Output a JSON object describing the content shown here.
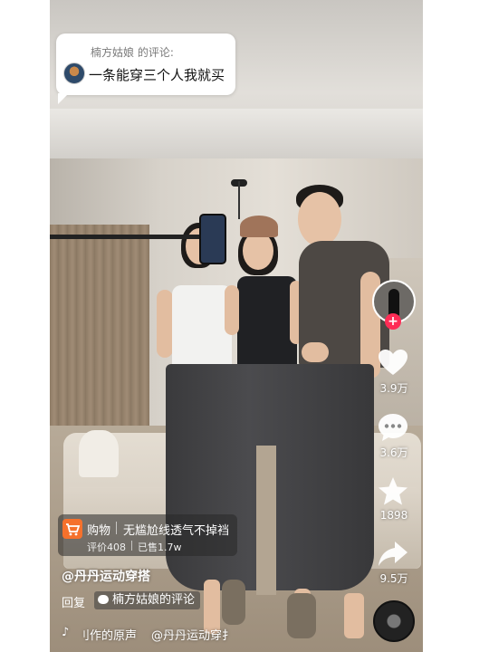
{
  "comment_popup": {
    "author": "楠方姑娘 的评论:",
    "text": "一条能穿三个人我就买"
  },
  "sidebar": {
    "likes": "3.9万",
    "comments": "3.6万",
    "favorites": "1898",
    "shares": "9.5万",
    "follow_symbol": "+"
  },
  "product_card": {
    "label": "购物",
    "title": "无尴尬线透气不掉裆",
    "rating": "评价408",
    "sold": "已售1.7w"
  },
  "author_handle": "@丹丹运动穿搭",
  "reply": {
    "label": "回复",
    "target": "楠方姑娘的评论"
  },
  "music": {
    "note": "♪",
    "title": "刂作的原声",
    "author": "@丹丹运动穿扌"
  },
  "colors": {
    "like_red": "#fe2c55",
    "cart_orange": "#f5712c"
  }
}
